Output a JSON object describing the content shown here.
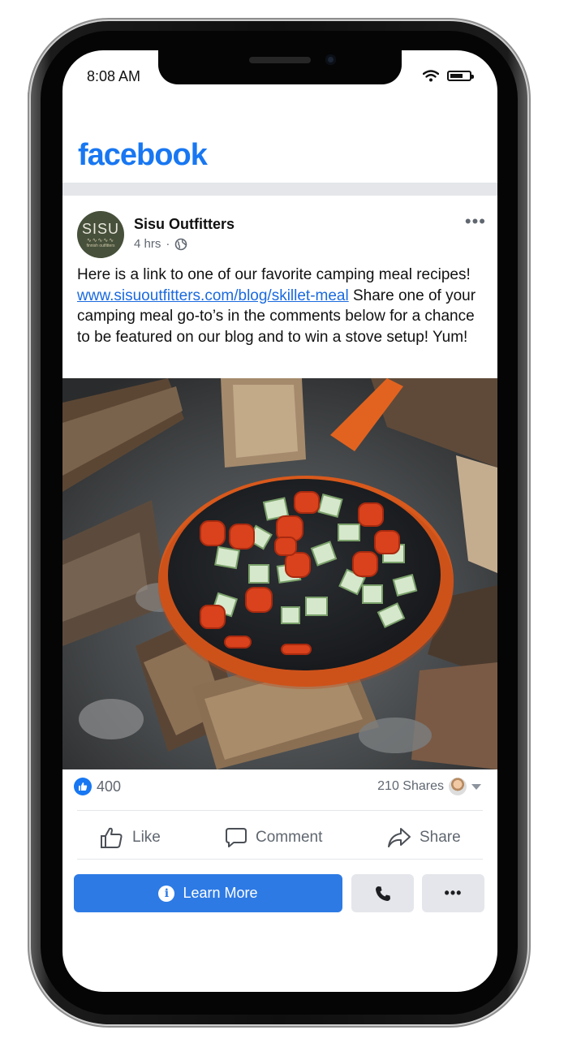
{
  "status_bar": {
    "time": "8:08 AM"
  },
  "app": {
    "name": "facebook"
  },
  "post": {
    "page_name": "Sisu Outfitters",
    "avatar": {
      "main_text": "SISU",
      "wave": "∿∿∿∿∿",
      "sub_text": "finnish outfitters"
    },
    "time_ago": "4 hrs",
    "text_before_link": "Here is a link to one of our favorite camping meal recipes! ",
    "link_text": "www.sisuoutfitters.com/blog/skillet-meal",
    "text_after_link": " Share one of your camping meal go-to’s in the comments below for a chance to be featured on our blog and to win a stove setup! Yum!",
    "image_icon": "skillet-over-campfire-image"
  },
  "engagement": {
    "reaction_count": "400",
    "shares": "210 Shares"
  },
  "actions": {
    "like": "Like",
    "comment": "Comment",
    "share": "Share"
  },
  "cta": {
    "learn_more": "Learn More"
  },
  "colors": {
    "facebook_blue": "#1877f2",
    "cta_blue": "#2d7ae5",
    "link_blue": "#1a6adf",
    "secondary_gray": "#e4e6eb"
  }
}
